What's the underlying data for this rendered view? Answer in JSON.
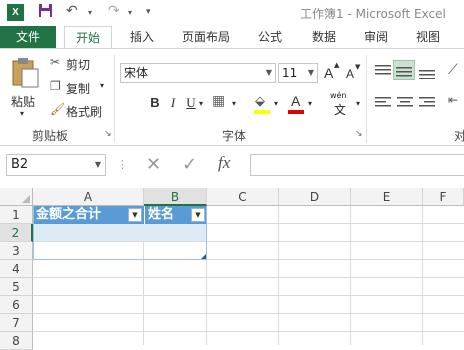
{
  "titlebar": {
    "app_icon": "X",
    "title": "工作簿1 - Microsoft Excel",
    "icons": [
      "excel-logo",
      "save-icon",
      "undo-icon",
      "redo-icon",
      "customize-qat-icon"
    ]
  },
  "tabs": {
    "file": "文件",
    "home": "开始",
    "insert": "插入",
    "page_layout": "页面布局",
    "formulas": "公式",
    "data": "数据",
    "review": "审阅",
    "view": "视图"
  },
  "clipboard": {
    "paste": "粘贴",
    "cut": "剪切",
    "copy": "复制",
    "format_painter": "格式刷",
    "group_label": "剪贴板"
  },
  "font": {
    "name": "宋体",
    "size": "11",
    "bold": "B",
    "italic": "I",
    "underline": "U",
    "wen": "wén",
    "wen_char": "文",
    "grow": "A",
    "shrink": "A",
    "group_label": "字体"
  },
  "alignment": {
    "group_label_partial": "对"
  },
  "formula_bar": {
    "name_box": "B2",
    "cancel": "✕",
    "enter": "✓",
    "fx": "fx",
    "value": ""
  },
  "grid": {
    "columns": [
      "A",
      "B",
      "C",
      "D",
      "E",
      "F"
    ],
    "rows": [
      "1",
      "2",
      "3",
      "4",
      "5",
      "6",
      "7",
      "8"
    ],
    "selected_cell": "B2",
    "header_row": {
      "A1": "金额之合计",
      "B1": "姓名"
    }
  },
  "colors": {
    "excel_green": "#217346",
    "table_header": "#5b9bd5",
    "table_band": "#ddebf7"
  }
}
